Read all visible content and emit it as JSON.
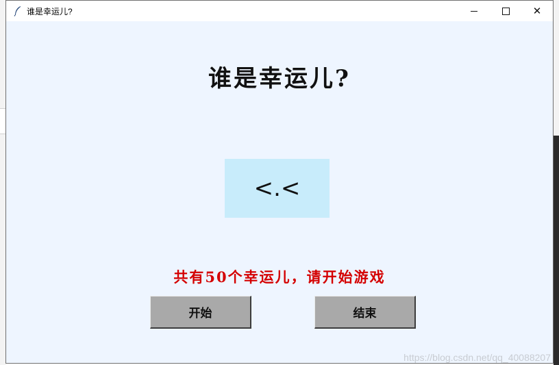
{
  "window": {
    "title": "谁是幸运儿?",
    "controls": {
      "minimize": "minimize",
      "maximize": "maximize",
      "close": "✕"
    }
  },
  "app": {
    "heading": "谁是幸运儿?",
    "display_text": "<.<",
    "status_text": "共有50个幸运儿，请开始游戏",
    "buttons": {
      "start": "开始",
      "end": "结束"
    }
  },
  "watermark": "https://blog.csdn.net/qq_40088207",
  "colors": {
    "window_bg": "#eef5ff",
    "display_bg": "#c8ecfb",
    "status_text": "#d40000",
    "button_bg": "#a9a9a9"
  }
}
